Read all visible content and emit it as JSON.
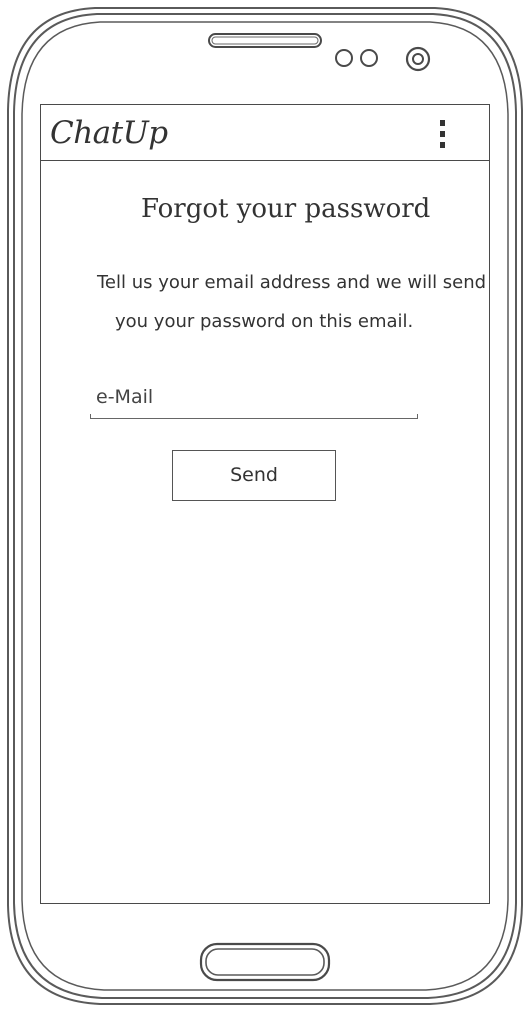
{
  "app_bar": {
    "title": "ChatUp",
    "menu_icon": "overflow-menu-icon"
  },
  "content": {
    "title": "Forgot your password",
    "description_line_1": "Tell us your email address and we will send",
    "description_line_2": "you your password on this email.",
    "email_field": {
      "placeholder": "e-Mail",
      "value": ""
    },
    "send_button": "Send"
  },
  "device": {
    "speaker_icon": "speaker-grille-icon",
    "sensor_icon": "sensor-icon",
    "camera_icon": "front-camera-icon",
    "home_button_icon": "home-button-icon"
  },
  "colors": {
    "stroke": "#4a4a4a",
    "text": "#333333",
    "background": "#ffffff"
  }
}
